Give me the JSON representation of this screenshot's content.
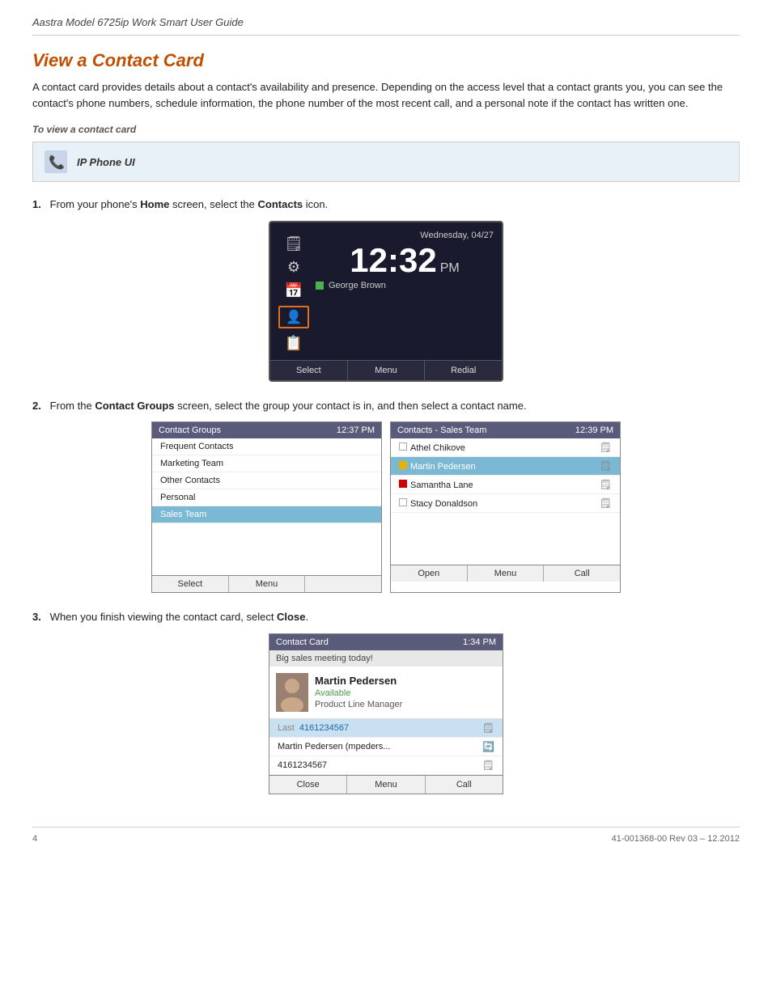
{
  "header": {
    "title": "Aastra Model 6725ip Work Smart User Guide"
  },
  "section": {
    "title": "View a Contact Card",
    "description": "A contact card provides details about a contact's availability and presence. Depending on the access level that a contact grants you, you can see the contact's phone numbers, schedule information, the phone number of the most recent call, and a personal note if the contact has written one.",
    "sub_heading": "To view a contact card",
    "ip_phone_label": "IP Phone UI"
  },
  "steps": [
    {
      "number": "1",
      "text": "From your phone's Home screen, select the Contacts icon.",
      "bold_words": [
        "Home",
        "Contacts"
      ]
    },
    {
      "number": "2",
      "text": "From the Contact Groups screen, select the group your contact is in, and then select a contact name.",
      "bold_words": [
        "Contact Groups"
      ]
    },
    {
      "number": "3",
      "text": "When you finish viewing the contact card, select Close.",
      "bold_words": [
        "Close"
      ]
    }
  ],
  "phone_screen": {
    "date": "Wednesday, 04/27",
    "time": "12:32",
    "ampm": "PM",
    "presence_name": "George Brown",
    "softkeys": [
      "Select",
      "Menu",
      "Redial"
    ]
  },
  "contact_groups_screen": {
    "title": "Contact Groups",
    "time": "12:37 PM",
    "groups": [
      "Frequent Contacts",
      "Marketing Team",
      "Other Contacts",
      "Personal",
      "Sales Team"
    ],
    "selected": "Sales Team",
    "softkeys": [
      "Select",
      "Menu"
    ]
  },
  "contacts_sales_screen": {
    "title": "Contacts - Sales Team",
    "time": "12:39 PM",
    "contacts": [
      {
        "name": "Athel Chikove",
        "status": "empty"
      },
      {
        "name": "Martin Pedersen",
        "status": "yellow"
      },
      {
        "name": "Samantha Lane",
        "status": "red"
      },
      {
        "name": "Stacy Donaldson",
        "status": "empty"
      }
    ],
    "selected": "Martin Pedersen",
    "softkeys": [
      "Open",
      "Menu",
      "Call"
    ]
  },
  "contact_card_screen": {
    "title": "Contact Card",
    "time": "1:34 PM",
    "note": "Big sales meeting today!",
    "name": "Martin Pedersen",
    "status": "Available",
    "job_title": "Product Line Manager",
    "last_label": "Last",
    "phone_number": "4161234567",
    "contact_row": "Martin Pedersen (mpeders...",
    "phone_number2": "4161234567",
    "softkeys": [
      "Close",
      "Menu",
      "Call"
    ]
  },
  "footer": {
    "page": "4",
    "doc_ref": "41-001368-00 Rev 03 – 12.2012"
  }
}
